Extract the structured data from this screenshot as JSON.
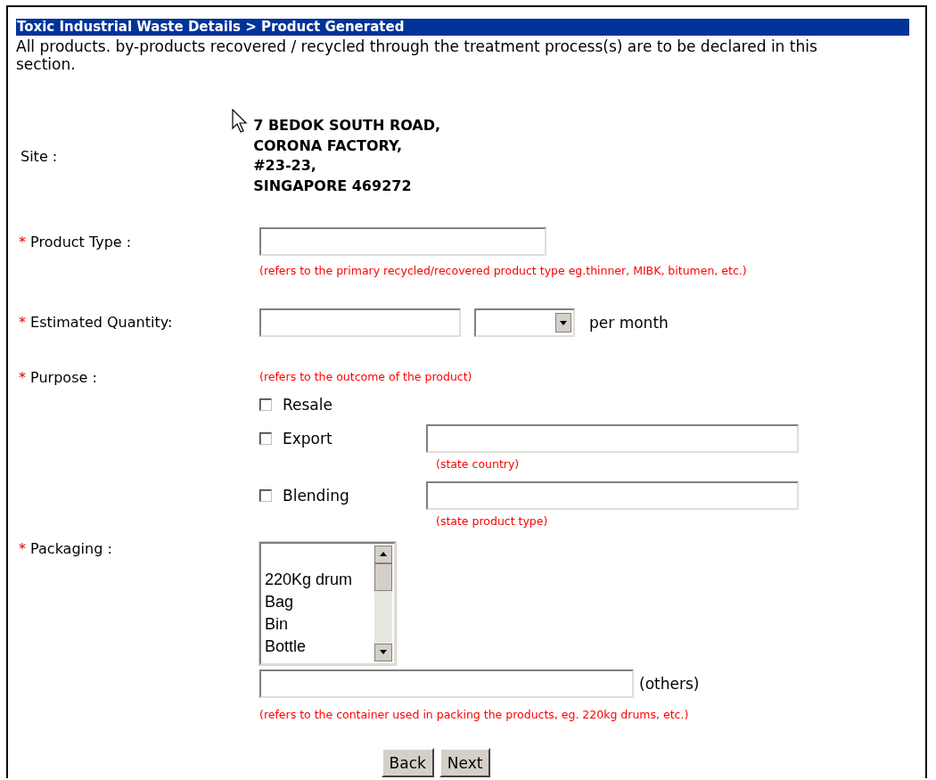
{
  "header": {
    "breadcrumb": "Toxic Industrial Waste Details > Product Generated"
  },
  "description": "All products. by-products recovered / recycled through the treatment process(s) are to be declared in this section.",
  "site": {
    "label": "Site :",
    "address_lines": [
      "7 BEDOK SOUTH ROAD,",
      "CORONA FACTORY,",
      "#23-23,",
      "SINGAPORE 469272"
    ]
  },
  "product_type": {
    "marker": "*",
    "label": "Product Type :",
    "hint": "(refers to the primary recycled/recovered product type eg.thinner, MIBK, bitumen, etc.)"
  },
  "quantity": {
    "marker": "*",
    "label": "Estimated Quantity:",
    "suffix": "per month"
  },
  "purpose": {
    "marker": "*",
    "label": "Purpose :",
    "hint": "(refers to the outcome of the product)",
    "options": [
      {
        "kind": "plain",
        "label": "Resale",
        "checked": false
      },
      {
        "kind": "with_field",
        "label": "Export",
        "checked": false,
        "hint": "(state country)"
      },
      {
        "kind": "with_field",
        "label": "Blending",
        "checked": false,
        "hint": "(state product type)"
      }
    ]
  },
  "packaging": {
    "marker": "*",
    "label": "Packaging :",
    "options": [
      {
        "label": "220Kg drum",
        "selected": false
      },
      {
        "label": "Bag",
        "selected": false
      },
      {
        "label": "Bin",
        "selected": false
      },
      {
        "label": "Bottle",
        "selected": false
      }
    ],
    "others_label": "(others)",
    "hint": "(refers to the container used in packing the products, eg. 220kg drums, etc.)"
  },
  "buttons": [
    {
      "label": "Back"
    },
    {
      "label": "Next"
    }
  ]
}
